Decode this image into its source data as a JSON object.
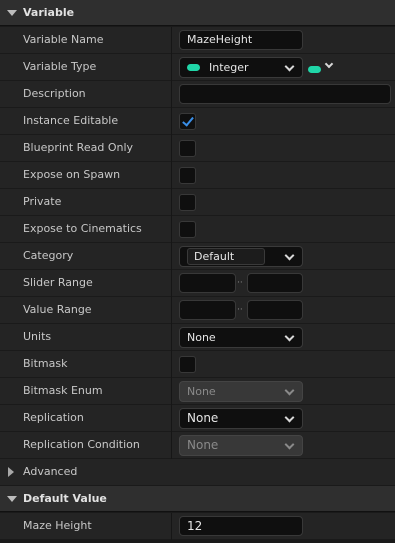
{
  "sections": {
    "variable": "Variable",
    "advanced": "Advanced",
    "default_value": "Default Value"
  },
  "rows": {
    "variable_name": {
      "label": "Variable Name",
      "value": "MazeHeight"
    },
    "variable_type": {
      "label": "Variable Type",
      "value": "Integer",
      "pin_color": "#20d6a8"
    },
    "description": {
      "label": "Description",
      "value": ""
    },
    "instance_editable": {
      "label": "Instance Editable",
      "checked": true
    },
    "blueprint_read_only": {
      "label": "Blueprint Read Only",
      "checked": false
    },
    "expose_on_spawn": {
      "label": "Expose on Spawn",
      "checked": false
    },
    "private": {
      "label": "Private",
      "checked": false
    },
    "expose_to_cinematics": {
      "label": "Expose to Cinematics",
      "checked": false
    },
    "category": {
      "label": "Category",
      "value": "Default"
    },
    "slider_range": {
      "label": "Slider Range",
      "min": "",
      "max": "",
      "separator": "··"
    },
    "value_range": {
      "label": "Value Range",
      "min": "",
      "max": "",
      "separator": "··"
    },
    "units": {
      "label": "Units",
      "value": "None"
    },
    "bitmask": {
      "label": "Bitmask",
      "checked": false
    },
    "bitmask_enum": {
      "label": "Bitmask Enum",
      "value": "None"
    },
    "replication": {
      "label": "Replication",
      "value": "None"
    },
    "replication_condition": {
      "label": "Replication Condition",
      "value": "None"
    },
    "maze_height": {
      "label": "Maze Height",
      "value": "12"
    }
  }
}
